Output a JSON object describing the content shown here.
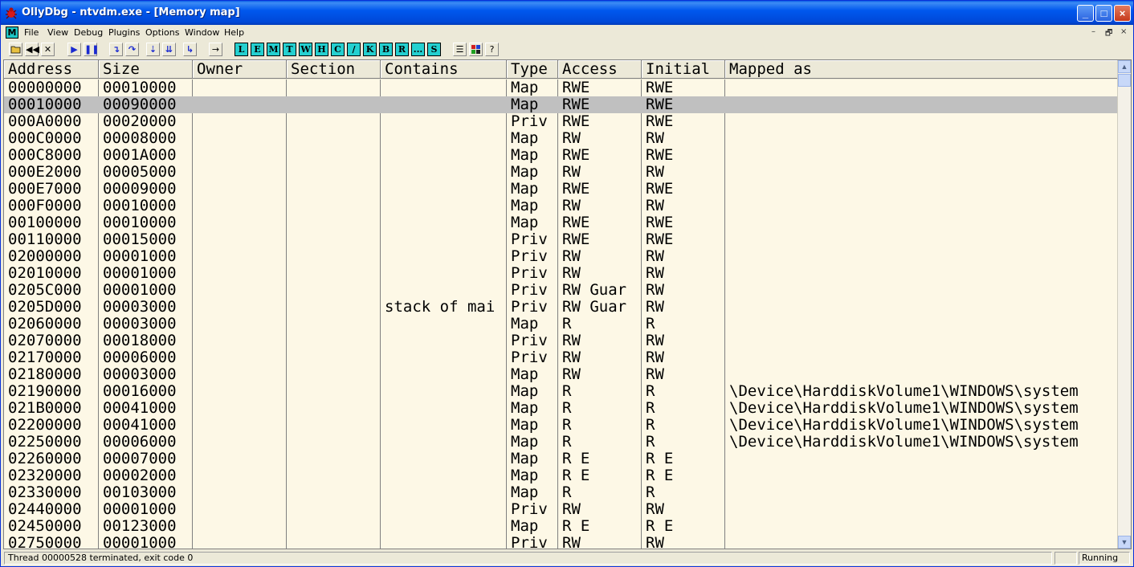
{
  "window": {
    "title": "OllyDbg - ntvdm.exe - [Memory map]",
    "minimize": "_",
    "maximize": "□",
    "close": "×"
  },
  "menu": {
    "mdi_icon": "M",
    "items": [
      "File",
      "View",
      "Debug",
      "Plugins",
      "Options",
      "Window",
      "Help"
    ],
    "mdi_min": "–",
    "mdi_restore": "🗗",
    "mdi_close": "×"
  },
  "toolbar": {
    "buttons": [
      "open-icon",
      "rewind-icon",
      "close-icon",
      "run-icon",
      "pause-icon",
      "step-into-icon",
      "step-over-icon",
      "trace-into-icon",
      "trace-over-icon",
      "execute-till-return-icon",
      "goto-icon"
    ],
    "window_letters": [
      "L",
      "E",
      "M",
      "T",
      "W",
      "H",
      "C",
      "/",
      "K",
      "B",
      "R",
      "...",
      "S"
    ],
    "extra": [
      "list-icon",
      "grid-icon",
      "help-icon"
    ]
  },
  "table": {
    "columns": [
      "Address",
      "Size",
      "Owner",
      "Section",
      "Contains",
      "Type",
      "Access",
      "Initial",
      "Mapped as"
    ],
    "selected_row": 1,
    "rows": [
      [
        "00000000",
        "00010000",
        "",
        "",
        "",
        "Map",
        "RWE",
        "RWE",
        ""
      ],
      [
        "00010000",
        "00090000",
        "",
        "",
        "",
        "Map",
        "RWE",
        "RWE",
        ""
      ],
      [
        "000A0000",
        "00020000",
        "",
        "",
        "",
        "Priv",
        "RWE",
        "RWE",
        ""
      ],
      [
        "000C0000",
        "00008000",
        "",
        "",
        "",
        "Map",
        "RW",
        "RW",
        ""
      ],
      [
        "000C8000",
        "0001A000",
        "",
        "",
        "",
        "Map",
        "RWE",
        "RWE",
        ""
      ],
      [
        "000E2000",
        "00005000",
        "",
        "",
        "",
        "Map",
        "RW",
        "RW",
        ""
      ],
      [
        "000E7000",
        "00009000",
        "",
        "",
        "",
        "Map",
        "RWE",
        "RWE",
        ""
      ],
      [
        "000F0000",
        "00010000",
        "",
        "",
        "",
        "Map",
        "RW",
        "RW",
        ""
      ],
      [
        "00100000",
        "00010000",
        "",
        "",
        "",
        "Map",
        "RWE",
        "RWE",
        ""
      ],
      [
        "00110000",
        "00015000",
        "",
        "",
        "",
        "Priv",
        "RWE",
        "RWE",
        ""
      ],
      [
        "02000000",
        "00001000",
        "",
        "",
        "",
        "Priv",
        "RW",
        "RW",
        ""
      ],
      [
        "02010000",
        "00001000",
        "",
        "",
        "",
        "Priv",
        "RW",
        "RW",
        ""
      ],
      [
        "0205C000",
        "00001000",
        "",
        "",
        "",
        "Priv",
        "RW  Guar",
        "RW",
        ""
      ],
      [
        "0205D000",
        "00003000",
        "",
        "",
        "stack of mai",
        "Priv",
        "RW  Guar",
        "RW",
        ""
      ],
      [
        "02060000",
        "00003000",
        "",
        "",
        "",
        "Map",
        "R",
        "R",
        ""
      ],
      [
        "02070000",
        "00018000",
        "",
        "",
        "",
        "Priv",
        "RW",
        "RW",
        ""
      ],
      [
        "02170000",
        "00006000",
        "",
        "",
        "",
        "Priv",
        "RW",
        "RW",
        ""
      ],
      [
        "02180000",
        "00003000",
        "",
        "",
        "",
        "Map",
        "RW",
        "RW",
        ""
      ],
      [
        "02190000",
        "00016000",
        "",
        "",
        "",
        "Map",
        "R",
        "R",
        "\\Device\\HarddiskVolume1\\WINDOWS\\system"
      ],
      [
        "021B0000",
        "00041000",
        "",
        "",
        "",
        "Map",
        "R",
        "R",
        "\\Device\\HarddiskVolume1\\WINDOWS\\system"
      ],
      [
        "02200000",
        "00041000",
        "",
        "",
        "",
        "Map",
        "R",
        "R",
        "\\Device\\HarddiskVolume1\\WINDOWS\\system"
      ],
      [
        "02250000",
        "00006000",
        "",
        "",
        "",
        "Map",
        "R",
        "R",
        "\\Device\\HarddiskVolume1\\WINDOWS\\system"
      ],
      [
        "02260000",
        "00007000",
        "",
        "",
        "",
        "Map",
        "R E",
        "R E",
        ""
      ],
      [
        "02320000",
        "00002000",
        "",
        "",
        "",
        "Map",
        "R E",
        "R E",
        ""
      ],
      [
        "02330000",
        "00103000",
        "",
        "",
        "",
        "Map",
        "R",
        "R",
        ""
      ],
      [
        "02440000",
        "00001000",
        "",
        "",
        "",
        "Priv",
        "RW",
        "RW",
        ""
      ],
      [
        "02450000",
        "00123000",
        "",
        "",
        "",
        "Map",
        "R E",
        "R E",
        ""
      ],
      [
        "02750000",
        "00001000",
        "",
        "",
        "",
        "Priv",
        "RW",
        "RW",
        ""
      ]
    ]
  },
  "status": {
    "message": "Thread 00000528 terminated, exit code 0",
    "state": "Running"
  }
}
